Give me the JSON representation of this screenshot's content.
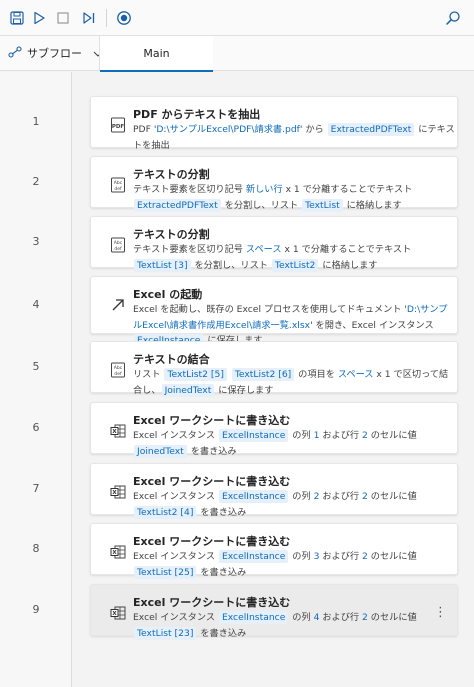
{
  "toolbar": {
    "icons": [
      "save-icon",
      "run-icon",
      "stop-icon",
      "step-icon",
      "record-icon",
      "search-icon"
    ]
  },
  "tabs": {
    "subflow_label": "サブフロー",
    "main_label": "Main"
  },
  "actions": [
    {
      "no": "1",
      "icon": "pdf-text-icon",
      "title": "PDF からテキストを抽出",
      "desc": [
        {
          "t": "PDF '"
        },
        {
          "t": "D:\\サンプルExcel\\PDF\\請求書.pdf",
          "style": "link"
        },
        {
          "t": "' から "
        },
        {
          "t": "ExtractedPDFText",
          "style": "tok"
        },
        {
          "t": " にテキストを抽出"
        }
      ]
    },
    {
      "no": "2",
      "icon": "split-text-icon",
      "title": "テキストの分割",
      "desc": [
        {
          "t": "テキスト要素を区切り記号 "
        },
        {
          "t": "新しい行",
          "style": "link"
        },
        {
          "t": " x 1 で分離することでテキスト "
        },
        {
          "t": "ExtractedPDFText",
          "style": "tok"
        },
        {
          "t": " を分割し、リスト "
        },
        {
          "t": "TextList",
          "style": "tok"
        },
        {
          "t": " に格納します"
        }
      ]
    },
    {
      "no": "3",
      "icon": "split-text-icon",
      "title": "テキストの分割",
      "desc": [
        {
          "t": "テキスト要素を区切り記号 "
        },
        {
          "t": "スペース",
          "style": "link"
        },
        {
          "t": " x 1 で分離することでテキスト "
        },
        {
          "t": "TextList [3]",
          "style": "tok"
        },
        {
          "t": " を分割し、リスト "
        },
        {
          "t": "TextList2",
          "style": "tok"
        },
        {
          "t": " に格納します"
        }
      ]
    },
    {
      "no": "4",
      "icon": "launch-arrow-icon",
      "title": "Excel の起動",
      "desc": [
        {
          "t": "Excel を起動し、既存の Excel プロセスを使用してドキュメント '"
        },
        {
          "t": "D:\\サンプルExcel\\請求書作成用Excel\\請求一覧.xlsx",
          "style": "link"
        },
        {
          "t": "' を開き、Excel インスタンス "
        },
        {
          "t": "ExcelInstance",
          "style": "tok"
        },
        {
          "t": " に保存します。"
        }
      ]
    },
    {
      "no": "5",
      "icon": "join-text-icon",
      "title": "テキストの結合",
      "desc": [
        {
          "t": "リスト "
        },
        {
          "t": "TextList2 [5]",
          "style": "tok"
        },
        {
          "t": " "
        },
        {
          "t": "TextList2 [6]",
          "style": "tok"
        },
        {
          "t": " の項目を "
        },
        {
          "t": "スペース",
          "style": "link"
        },
        {
          "t": " x 1 で区切って結合し、"
        },
        {
          "t": "JoinedText",
          "style": "tok"
        },
        {
          "t": " に保存します"
        }
      ]
    },
    {
      "no": "6",
      "icon": "excel-write-icon",
      "title": "Excel ワークシートに書き込む",
      "desc": [
        {
          "t": "Excel インスタンス "
        },
        {
          "t": "ExcelInstance",
          "style": "tok"
        },
        {
          "t": " の列 "
        },
        {
          "t": "1",
          "style": "link"
        },
        {
          "t": " および行 "
        },
        {
          "t": "2",
          "style": "link"
        },
        {
          "t": " のセルに値 "
        },
        {
          "t": "JoinedText",
          "style": "tok"
        },
        {
          "t": " を書き込み"
        }
      ]
    },
    {
      "no": "7",
      "icon": "excel-write-icon",
      "title": "Excel ワークシートに書き込む",
      "desc": [
        {
          "t": "Excel インスタンス "
        },
        {
          "t": "ExcelInstance",
          "style": "tok"
        },
        {
          "t": " の列 "
        },
        {
          "t": "2",
          "style": "link"
        },
        {
          "t": " および行 "
        },
        {
          "t": "2",
          "style": "link"
        },
        {
          "t": " のセルに値 "
        },
        {
          "t": "TextList2 [4]",
          "style": "tok"
        },
        {
          "t": " を書き込み"
        }
      ]
    },
    {
      "no": "8",
      "icon": "excel-write-icon",
      "title": "Excel ワークシートに書き込む",
      "desc": [
        {
          "t": "Excel インスタンス "
        },
        {
          "t": "ExcelInstance",
          "style": "tok"
        },
        {
          "t": " の列 "
        },
        {
          "t": "3",
          "style": "link"
        },
        {
          "t": " および行 "
        },
        {
          "t": "2",
          "style": "link"
        },
        {
          "t": " のセルに値 "
        },
        {
          "t": "TextList [25]",
          "style": "tok"
        },
        {
          "t": " を書き込み"
        }
      ]
    },
    {
      "no": "9",
      "icon": "excel-write-icon",
      "title": "Excel ワークシートに書き込む",
      "desc": [
        {
          "t": "Excel インスタンス "
        },
        {
          "t": "ExcelInstance",
          "style": "tok"
        },
        {
          "t": " の列 "
        },
        {
          "t": "4",
          "style": "link"
        },
        {
          "t": " および行 "
        },
        {
          "t": "2",
          "style": "link"
        },
        {
          "t": " のセルに値 "
        },
        {
          "t": "TextList [23]",
          "style": "tok"
        },
        {
          "t": " を書き込み"
        }
      ],
      "selected": true,
      "more_icon": "⋮"
    }
  ],
  "colors": {
    "accent": "#0f6cbd",
    "token_bg": "#e6f0fb",
    "record": "#0f6cbd"
  }
}
